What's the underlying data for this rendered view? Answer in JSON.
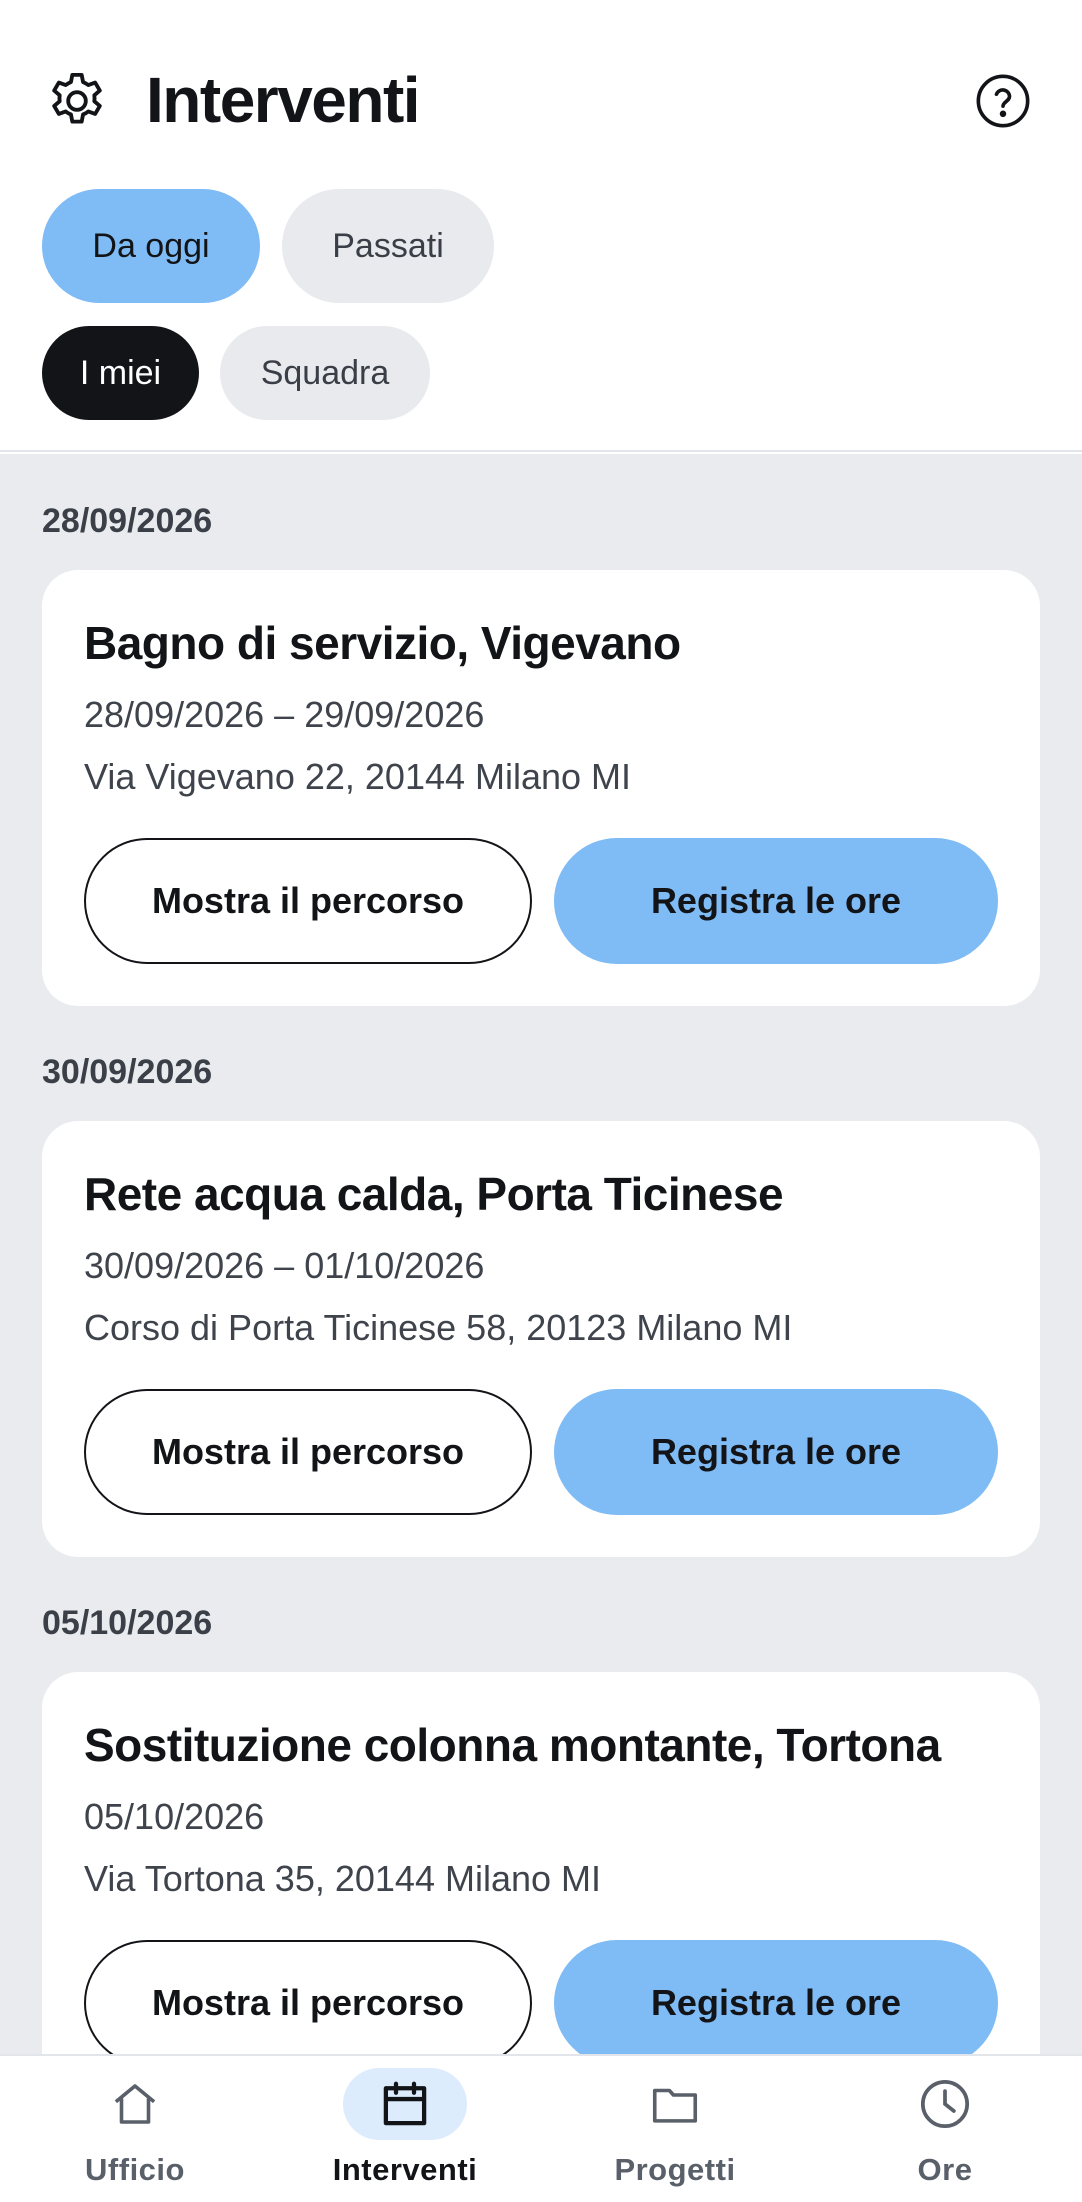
{
  "header": {
    "title": "Interventi",
    "settings_icon": "gear-icon",
    "help_icon": "help-circle-icon"
  },
  "filters": {
    "period": [
      {
        "label": "Da oggi",
        "selected": true
      },
      {
        "label": "Passati",
        "selected": false
      }
    ],
    "scope": [
      {
        "label": "I miei",
        "selected": true
      },
      {
        "label": "Squadra",
        "selected": false
      }
    ]
  },
  "interventions": [
    {
      "group_date": "28/09/2026",
      "title": "Bagno di servizio, Vigevano",
      "dates": "28/09/2026 – 29/09/2026",
      "address": "Via Vigevano 22, 20144 Milano MI",
      "route_label": "Mostra il percorso",
      "hours_label": "Registra le ore"
    },
    {
      "group_date": "30/09/2026",
      "title": "Rete acqua calda, Porta Ticinese",
      "dates": "30/09/2026 – 01/10/2026",
      "address": "Corso di Porta Ticinese 58, 20123 Milano MI",
      "route_label": "Mostra il percorso",
      "hours_label": "Registra le ore"
    },
    {
      "group_date": "05/10/2026",
      "title": "Sostituzione colonna montante, Tortona",
      "dates": "05/10/2026",
      "address": "Via Tortona 35, 20144 Milano MI",
      "route_label": "Mostra il percorso",
      "hours_label": "Registra le ore"
    }
  ],
  "nav": {
    "items": [
      {
        "label": "Ufficio",
        "icon": "home-icon",
        "active": false
      },
      {
        "label": "Interventi",
        "icon": "calendar-icon",
        "active": true
      },
      {
        "label": "Progetti",
        "icon": "folder-icon",
        "active": false
      },
      {
        "label": "Ore",
        "icon": "clock-icon",
        "active": false
      }
    ]
  },
  "colors": {
    "accent": "#7fbbf4",
    "dark": "#121418",
    "background": "#e9ebef",
    "nav_active_bg": "#dcecfd"
  }
}
